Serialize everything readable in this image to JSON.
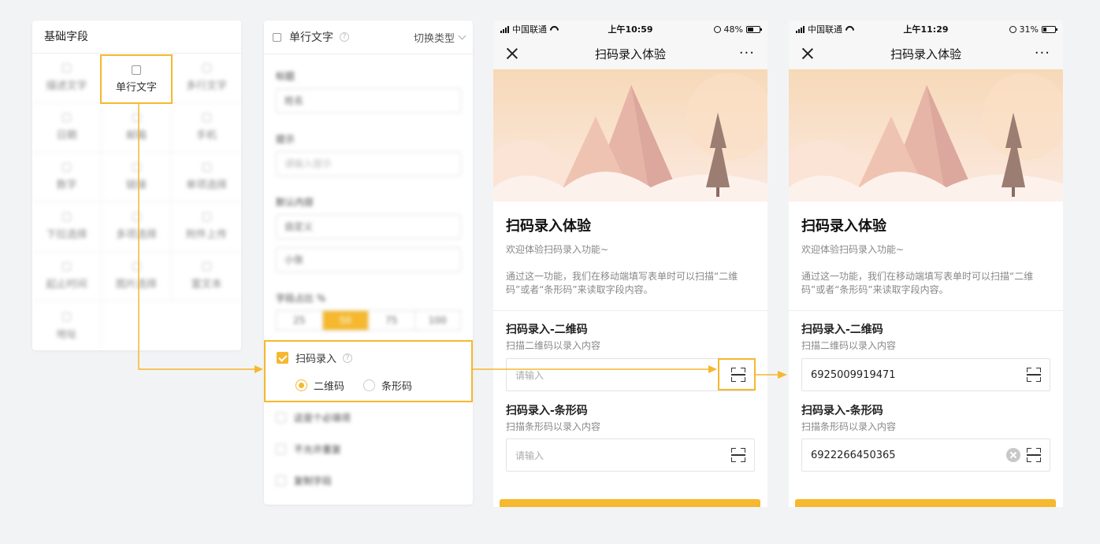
{
  "fields_panel": {
    "title": "基础字段",
    "items": [
      "描述文字",
      "单行文字",
      "多行文字",
      "日期",
      "邮箱",
      "手机",
      "数字",
      "链接",
      "单项选择",
      "下拉选择",
      "多项选择",
      "附件上传",
      "起止时间",
      "图片选择",
      "富文本",
      "地址"
    ],
    "selected_index": 1
  },
  "props_panel": {
    "type_name": "单行文字",
    "switch_label": "切换类型",
    "title_label": "标题",
    "title_value": "姓名",
    "hint_label": "提示",
    "hint_placeholder": "请输入提示",
    "default_label": "默认内容",
    "default_select": "自定义",
    "default_value": "小张",
    "width_label": "字段占比 %",
    "width_options": [
      "25",
      "50",
      "75",
      "100"
    ],
    "width_selected": "50",
    "scan_label": "扫码录入",
    "scan_checked": true,
    "scan_options": [
      "二维码",
      "条形码"
    ],
    "scan_selected": "二维码",
    "required_label": "这是个必填项",
    "nodup_label": "不允许重复",
    "copy_label": "复制字段"
  },
  "phones": [
    {
      "carrier": "中国联通",
      "time": "上午10:59",
      "battery": "48%",
      "battery_level": 0.48,
      "nav_title": "扫码录入体验",
      "more": "···",
      "form_title": "扫码录入体验",
      "form_subtitle": "欢迎体验扫码录入功能~",
      "form_desc": "通过这一功能，我们在移动端填写表单时可以扫描“二维码”或者“条形码”来读取字段内容。",
      "field1_label": "扫码录入-二维码",
      "field1_hint": "扫描二维码以录入内容",
      "field1_value": "",
      "field1_placeholder": "请输入",
      "field2_label": "扫码录入-条形码",
      "field2_hint": "扫描条形码以录入内容",
      "field2_value": "",
      "field2_placeholder": "请输入"
    },
    {
      "carrier": "中国联通",
      "time": "上午11:29",
      "battery": "31%",
      "battery_level": 0.31,
      "nav_title": "扫码录入体验",
      "more": "···",
      "form_title": "扫码录入体验",
      "form_subtitle": "欢迎体验扫码录入功能~",
      "form_desc": "通过这一功能，我们在移动端填写表单时可以扫描“二维码”或者“条形码”来读取字段内容。",
      "field1_label": "扫码录入-二维码",
      "field1_hint": "扫描二维码以录入内容",
      "field1_value": "6925009919471",
      "field1_placeholder": "请输入",
      "field2_label": "扫码录入-条形码",
      "field2_hint": "扫描条形码以录入内容",
      "field2_value": "6922266450365",
      "field2_placeholder": "请输入"
    }
  ],
  "colors": {
    "accent": "#f5b82e",
    "background": "#f2f3f5"
  },
  "icons": [
    "field-type-icon",
    "help-icon",
    "chevron-down-icon",
    "checkbox-icon",
    "radio-icon",
    "close-icon",
    "more-icon",
    "scan-icon",
    "clear-icon",
    "signal-icon",
    "wifi-icon",
    "battery-icon"
  ]
}
